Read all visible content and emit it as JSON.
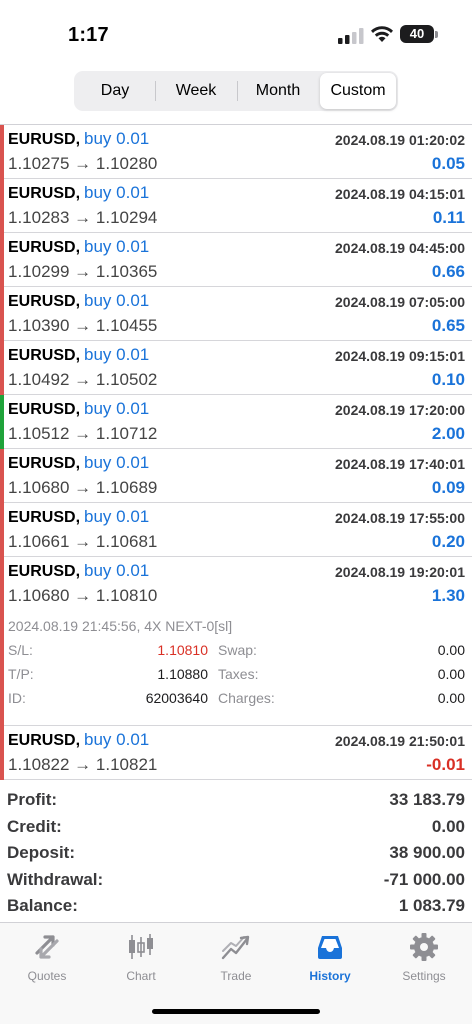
{
  "status": {
    "time": "1:17",
    "battery": "40",
    "battery_level": 0.4
  },
  "segments": [
    {
      "label": "Day"
    },
    {
      "label": "Week"
    },
    {
      "label": "Month"
    },
    {
      "label": "Custom",
      "active": true
    }
  ],
  "trades": [
    {
      "symbol": "EURUSD,",
      "side": "buy 0.01",
      "prices": "1.10275 → 1.10280",
      "time": "2024.08.19 01:20:02",
      "profit": "0.05"
    },
    {
      "symbol": "EURUSD,",
      "side": "buy 0.01",
      "prices": "1.10283 → 1.10294",
      "time": "2024.08.19 04:15:01",
      "profit": "0.11"
    },
    {
      "symbol": "EURUSD,",
      "side": "buy 0.01",
      "prices": "1.10299 → 1.10365",
      "time": "2024.08.19 04:45:00",
      "profit": "0.66"
    },
    {
      "symbol": "EURUSD,",
      "side": "buy 0.01",
      "prices": "1.10390 → 1.10455",
      "time": "2024.08.19 07:05:00",
      "profit": "0.65"
    },
    {
      "symbol": "EURUSD,",
      "side": "buy 0.01",
      "prices": "1.10492 → 1.10502",
      "time": "2024.08.19 09:15:01",
      "profit": "0.10"
    },
    {
      "symbol": "EURUSD,",
      "side": "buy 0.01",
      "prices": "1.10512 → 1.10712",
      "time": "2024.08.19 17:20:00",
      "profit": "2.00"
    },
    {
      "symbol": "EURUSD,",
      "side": "buy 0.01",
      "prices": "1.10680 → 1.10689",
      "time": "2024.08.19 17:40:01",
      "profit": "0.09"
    },
    {
      "symbol": "EURUSD,",
      "side": "buy 0.01",
      "prices": "1.10661 → 1.10681",
      "time": "2024.08.19 17:55:00",
      "profit": "0.20"
    },
    {
      "symbol": "EURUSD,",
      "side": "buy 0.01",
      "prices": "1.10680 → 1.10810",
      "time": "2024.08.19 19:20:01",
      "profit": "1.30"
    }
  ],
  "detail": {
    "header": "2024.08.19 21:45:56, 4X NEXT-0[sl]",
    "sl_label": "S/L:",
    "sl_value": "1.10810",
    "tp_label": "T/P:",
    "tp_value": "1.10880",
    "id_label": "ID:",
    "id_value": "62003640",
    "swap_label": "Swap:",
    "swap_value": "0.00",
    "taxes_label": "Taxes:",
    "taxes_value": "0.00",
    "charges_label": "Charges:",
    "charges_value": "0.00"
  },
  "last_trade": {
    "symbol": "EURUSD,",
    "side": "buy 0.01",
    "prices": "1.10822 → 1.10821",
    "time": "2024.08.19 21:50:01",
    "profit": "-0.01"
  },
  "summary": {
    "profit_label": "Profit:",
    "profit_value": "33 183.79",
    "credit_label": "Credit:",
    "credit_value": "0.00",
    "deposit_label": "Deposit:",
    "deposit_value": "38 900.00",
    "withdrawal_label": "Withdrawal:",
    "withdrawal_value": "-71 000.00",
    "balance_label": "Balance:",
    "balance_value": "1 083.79"
  },
  "tabs": [
    {
      "label": "Quotes"
    },
    {
      "label": "Chart"
    },
    {
      "label": "Trade"
    },
    {
      "label": "History"
    },
    {
      "label": "Settings"
    }
  ],
  "colors": {
    "accent": "#1a73d9",
    "loss": "#d93025",
    "sell_bar": "#d9534f",
    "buy_bar": "#1fa33a"
  }
}
